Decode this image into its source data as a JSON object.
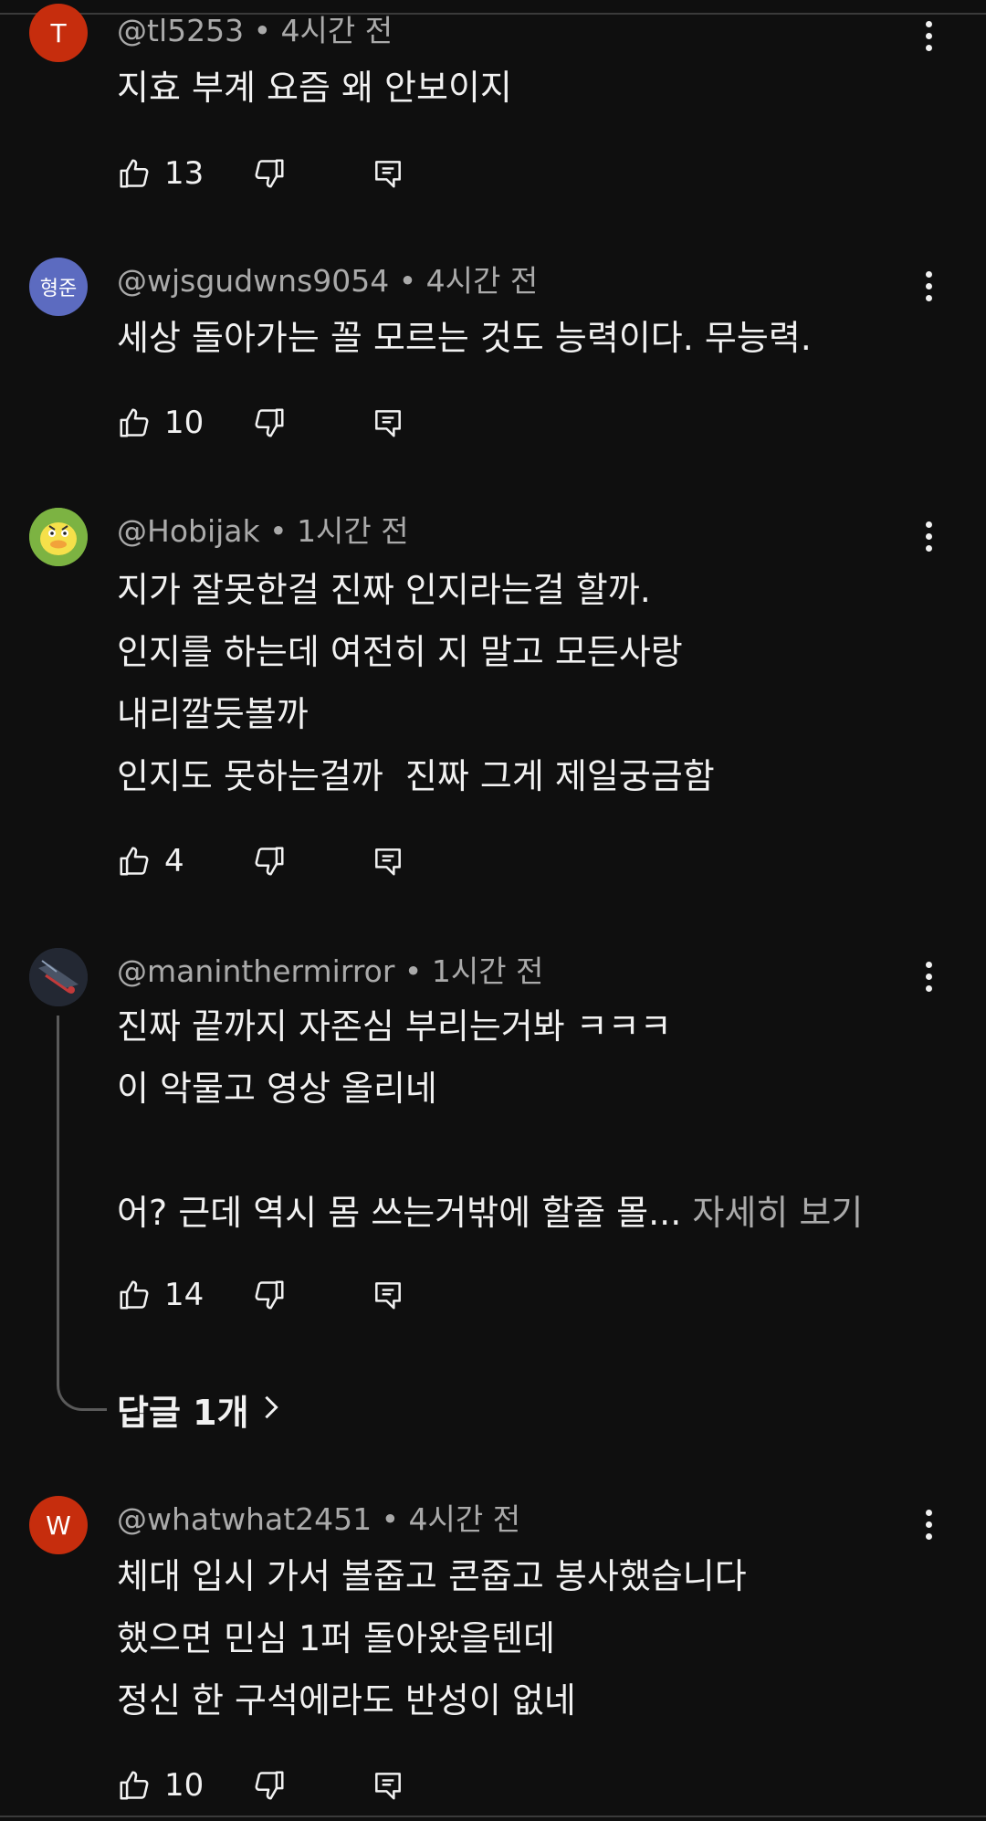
{
  "comments": [
    {
      "avatar_letter": "T",
      "avatar_color": "#c62d0d",
      "meta": "@tl5253 • 4시간 전",
      "lines": [
        "지효 부계 요즘 왜 안보이지"
      ],
      "likes": "13"
    },
    {
      "avatar_letter": "형준",
      "avatar_color": "#5c6bc0",
      "meta": "@wjsgudwns9054 • 4시간 전",
      "lines": [
        "세상 돌아가는 꼴 모르는 것도 능력이다. 무능력."
      ],
      "likes": "10"
    },
    {
      "avatar_letter": "",
      "avatar_color": "#7cb342",
      "meta": "@Hobijak • 1시간 전",
      "lines": [
        "지가 잘못한걸 진짜 인지라는걸 할까.",
        "인지를 하는데 여전히 지 말고 모든사랑",
        "내리깔듯볼까",
        "인지도 못하는걸까  진짜 그게 제일궁금함"
      ],
      "likes": "4"
    },
    {
      "avatar_letter": "",
      "avatar_color": "#2b3140",
      "meta": "@maninthermirror • 1시간 전",
      "lines": [
        "진짜 끝까지 자존심 부리는거봐 ㅋㅋㅋ",
        "이 악물고 영상 올리네",
        "",
        "어? 근데 역시 몸 쓰는거밖에 할줄 몰..."
      ],
      "read_more": "자세히 보기",
      "likes": "14",
      "replies_label": "답글 1개"
    },
    {
      "avatar_letter": "W",
      "avatar_color": "#c62d0d",
      "meta": "@whatwhat2451 • 4시간 전",
      "lines": [
        "체대 입시 가서 볼줍고 콘줍고 봉사했습니다",
        "했으면 민심 1퍼 돌아왔을텐데",
        "정신 한 구석에라도 반성이 없네"
      ],
      "likes": "10"
    }
  ],
  "icons": {
    "like": "thumbs-up-icon",
    "dislike": "thumbs-down-icon",
    "reply": "reply-comment-icon",
    "more": "more-vertical-icon",
    "chevron": "chevron-right-icon"
  }
}
